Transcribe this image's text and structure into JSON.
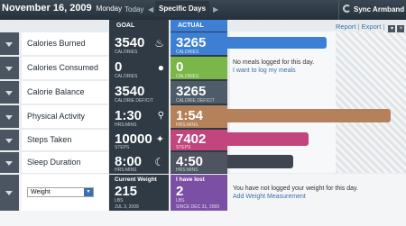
{
  "header": {
    "date": "November 16, 2009",
    "day": "Monday",
    "today": "Today",
    "specific_days": "Specific Days",
    "sync": "Sync Armband"
  },
  "toolbar": {
    "report": "Report",
    "sep": "|",
    "export": "Export",
    "sep2": "|"
  },
  "columns": {
    "goal": "GOAL",
    "actual": "ACTUAL"
  },
  "rows": [
    {
      "label": "Calories Burned",
      "goal": "3540",
      "goal_unit": "CALORIES",
      "actual": "3265",
      "actual_unit": "CALORIES",
      "color": "#3d7fd4",
      "fill": 0.94
    },
    {
      "label": "Calories Consumed",
      "goal": "0",
      "goal_unit": "CALORIES",
      "actual": "0",
      "actual_unit": "CALORIES",
      "color": "#7ab648",
      "message": "No meals logged for this day.",
      "link": "I want to log my meals"
    },
    {
      "label": "Calorie Balance",
      "goal": "3540",
      "goal_unit": "CALORIE DEFICIT",
      "actual": "3265",
      "actual_unit": "CALORIE DEFICIT",
      "color": "#4e5b68"
    },
    {
      "label": "Physical Activity",
      "goal": "1:30",
      "goal_unit": "HRS:MINS",
      "actual": "1:54",
      "actual_unit": "HRS:MINS",
      "color": "#b5815a",
      "fill": 1.0
    },
    {
      "label": "Steps Taken",
      "goal": "10000",
      "goal_unit": "STEPS",
      "actual": "7402",
      "actual_unit": "STEPS",
      "color": "#c2457e",
      "fill": 0.74
    },
    {
      "label": "Sleep Duration",
      "goal": "8:00",
      "goal_unit": "HRS:MINS",
      "actual": "4:50",
      "actual_unit": "HRS:MINS",
      "color": "#3f4650",
      "fill": 0.6
    }
  ],
  "weight": {
    "select_value": "Weight",
    "current_label": "Current Weight",
    "current_value": "215",
    "current_unit": "LBS",
    "current_date": "JUL 3, 2009",
    "lost_label": "I have lost",
    "lost_value": "2",
    "lost_unit": "LBS",
    "lost_since": "SINCE DEC 31, 2009",
    "lost_color": "#7b4fa3",
    "message": "You have not logged your weight for this day.",
    "link": "Add Weight Measurement"
  }
}
